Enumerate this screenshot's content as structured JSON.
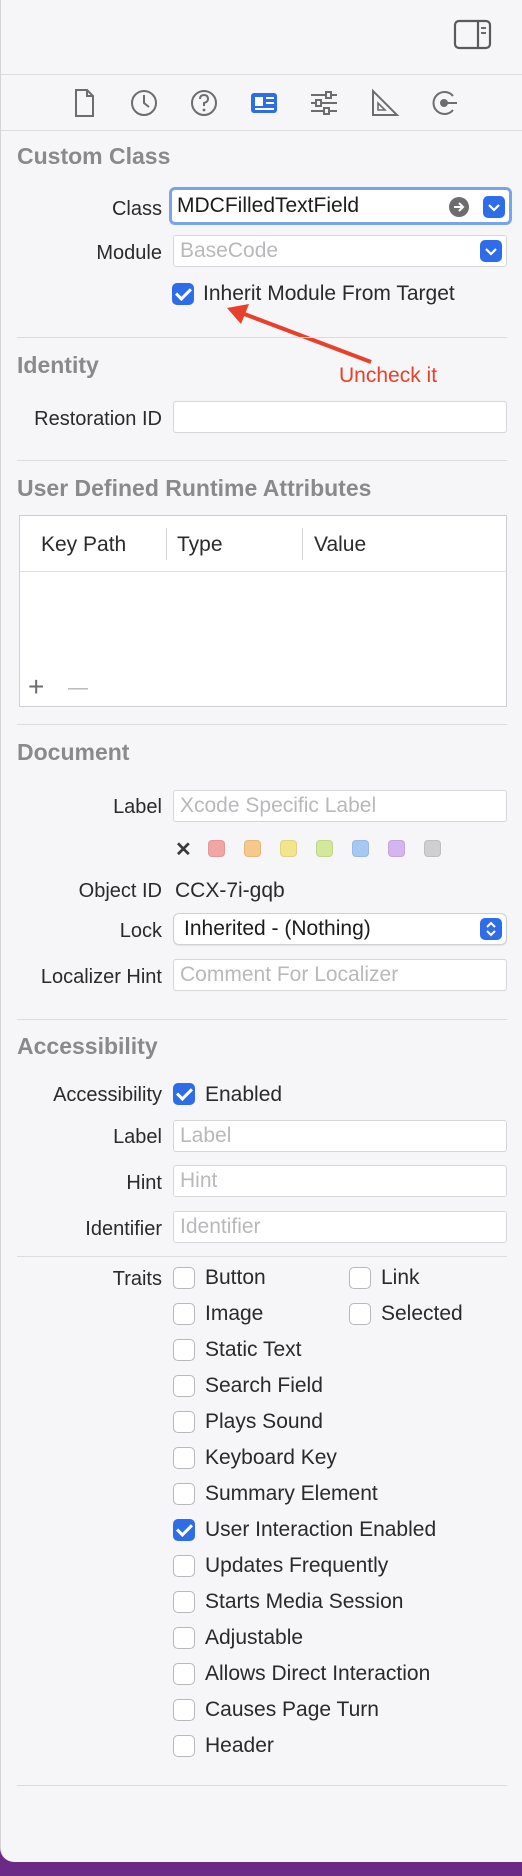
{
  "custom_class": {
    "title": "Custom Class",
    "class_label": "Class",
    "class_value": "MDCFilledTextField",
    "module_label": "Module",
    "module_placeholder": "BaseCode",
    "inherit_label": "Inherit Module From Target",
    "inherit_checked": true
  },
  "annotation": {
    "text": "Uncheck it",
    "color": "#e8412b"
  },
  "identity": {
    "title": "Identity",
    "restoration_label": "Restoration ID",
    "restoration_value": ""
  },
  "runtime_attributes": {
    "title": "User Defined Runtime Attributes",
    "columns": [
      "Key Path",
      "Type",
      "Value"
    ],
    "add_symbol": "+",
    "remove_symbol": "—"
  },
  "document": {
    "title": "Document",
    "label_label": "Label",
    "label_placeholder": "Xcode Specific Label",
    "clear_symbol": "✕",
    "swatches": [
      "#f2a6a3",
      "#f5c98a",
      "#f3e58d",
      "#d3e89a",
      "#a6c9f3",
      "#d4b5ee",
      "#cfcfd1"
    ],
    "object_id_label": "Object ID",
    "object_id_value": "CCX-7i-gqb",
    "lock_label": "Lock",
    "lock_value": "Inherited - (Nothing)",
    "localizer_label": "Localizer Hint",
    "localizer_placeholder": "Comment For Localizer"
  },
  "accessibility": {
    "title": "Accessibility",
    "accessibility_label": "Accessibility",
    "enabled_label": "Enabled",
    "enabled_checked": true,
    "label_label": "Label",
    "label_placeholder": "Label",
    "hint_label": "Hint",
    "hint_placeholder": "Hint",
    "identifier_label": "Identifier",
    "identifier_placeholder": "Identifier",
    "traits_label": "Traits",
    "traits": [
      {
        "label": "Button",
        "checked": false
      },
      {
        "label": "Link",
        "checked": false
      },
      {
        "label": "Image",
        "checked": false
      },
      {
        "label": "Selected",
        "checked": false
      },
      {
        "label": "Static Text",
        "checked": false
      },
      {
        "label": "Search Field",
        "checked": false
      },
      {
        "label": "Plays Sound",
        "checked": false
      },
      {
        "label": "Keyboard Key",
        "checked": false
      },
      {
        "label": "Summary Element",
        "checked": false
      },
      {
        "label": "User Interaction Enabled",
        "checked": true
      },
      {
        "label": "Updates Frequently",
        "checked": false
      },
      {
        "label": "Starts Media Session",
        "checked": false
      },
      {
        "label": "Adjustable",
        "checked": false
      },
      {
        "label": "Allows Direct Interaction",
        "checked": false
      },
      {
        "label": "Causes Page Turn",
        "checked": false
      },
      {
        "label": "Header",
        "checked": false
      }
    ]
  },
  "colors": {
    "accent": "#2f6de8",
    "panel_bg": "#f6f5f7",
    "window_edge": "#6b2a86"
  },
  "inspector_tabs": [
    "file-inspector-icon",
    "history-inspector-icon",
    "quick-help-icon",
    "identity-inspector-icon",
    "attributes-inspector-icon",
    "size-inspector-icon",
    "connections-inspector-icon"
  ]
}
